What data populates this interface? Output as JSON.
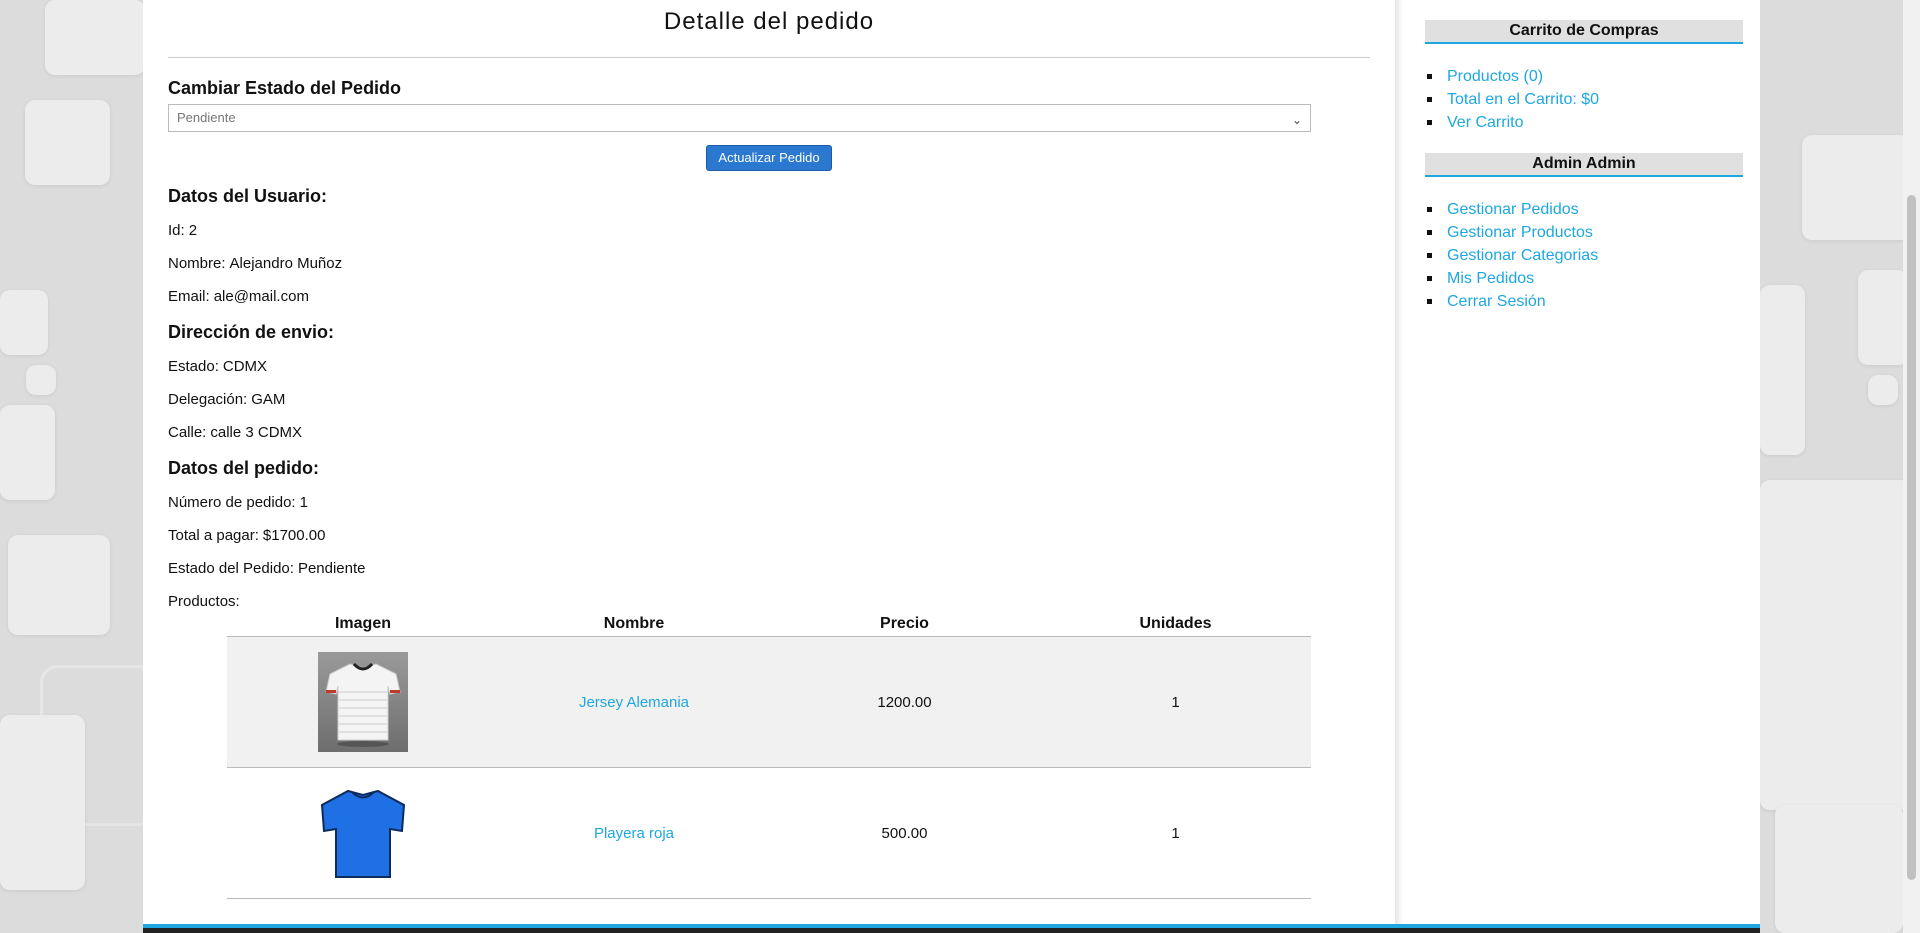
{
  "order_detail": {
    "title": "Detalle del pedido",
    "change_status": {
      "heading": "Cambiar Estado del Pedido",
      "selected": "Pendiente",
      "button_label": "Actualizar Pedido"
    },
    "user": {
      "heading": "Datos del Usuario:",
      "id_label": "Id:",
      "id": "2",
      "name_label": "Nombre:",
      "name": "Alejandro Muñoz",
      "email_label": "Email:",
      "email": "ale@mail.com"
    },
    "shipping": {
      "heading": "Dirección de envio:",
      "state_label": "Estado:",
      "state": "CDMX",
      "delegation_label": "Delegación:",
      "delegation": "GAM",
      "street_label": "Calle:",
      "street": "calle 3 CDMX"
    },
    "order": {
      "heading": "Datos del pedido:",
      "number_label": "Número de pedido:",
      "number": "1",
      "total_label": "Total a pagar:",
      "total": "$1700.00",
      "status_label": "Estado del Pedido:",
      "status": "Pendiente",
      "products_label": "Productos:"
    },
    "products_table": {
      "headers": [
        "Imagen",
        "Nombre",
        "Precio",
        "Unidades"
      ],
      "rows": [
        {
          "name": "Jersey Alemania",
          "price": "1200.00",
          "units": "1",
          "image_icon": "white-jersey-image"
        },
        {
          "name": "Playera roja",
          "price": "500.00",
          "units": "1",
          "image_icon": "blue-tshirt-image"
        }
      ]
    }
  },
  "sidebar": {
    "cart": {
      "heading": "Carrito de Compras",
      "items": [
        "Productos (0)",
        "Total en el Carrito: $0",
        "Ver Carrito"
      ]
    },
    "admin": {
      "heading": "Admin Admin",
      "items": [
        "Gestionar Pedidos",
        "Gestionar Productos",
        "Gestionar Categorias",
        "Mis Pedidos",
        "Cerrar Sesión"
      ]
    }
  },
  "colors": {
    "link": "#1ea7e0",
    "button": "#2b78d0",
    "accent_bar": "#1ea7e0"
  }
}
